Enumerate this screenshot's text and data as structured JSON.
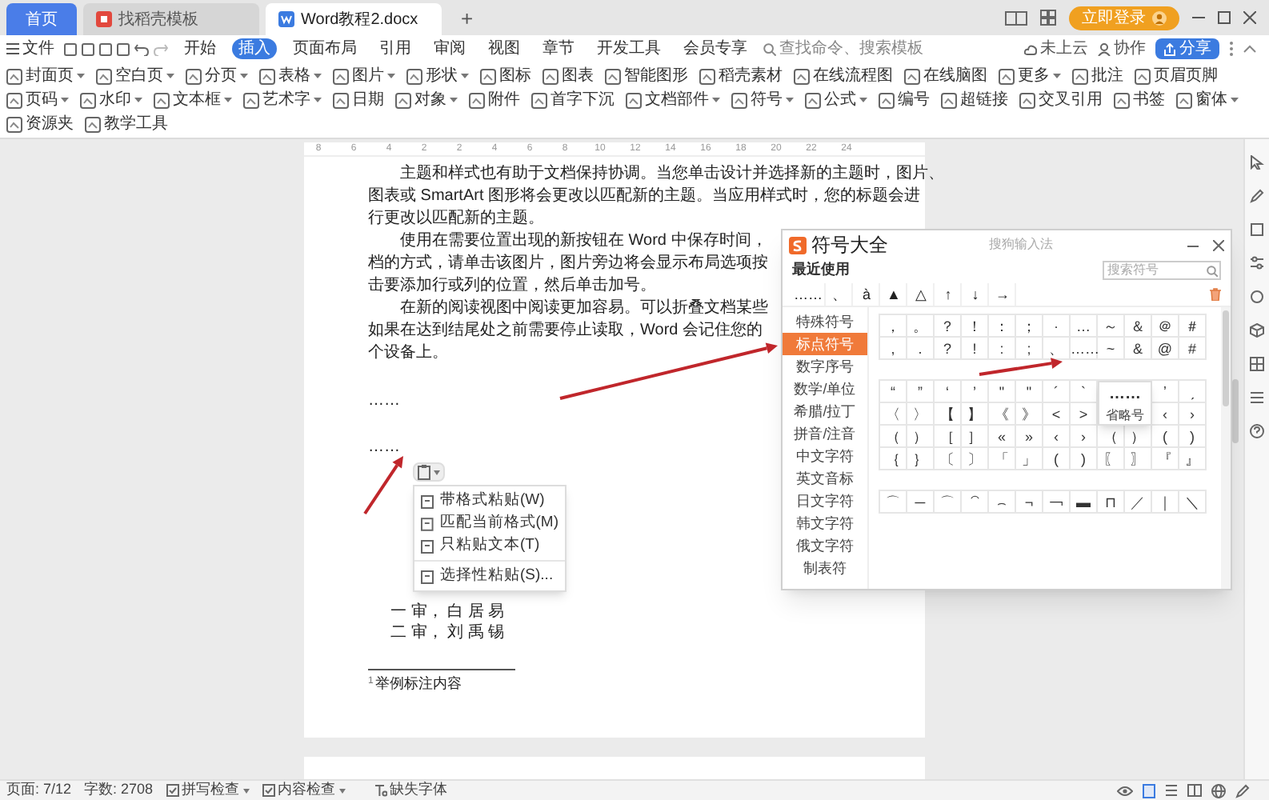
{
  "tabs": [
    {
      "label": "首页",
      "kind": "home",
      "selected": false
    },
    {
      "label": "找稻壳模板",
      "kind": "template",
      "selected": false
    },
    {
      "label": "Word教程2.docx",
      "kind": "doc",
      "selected": true
    }
  ],
  "new_tab": "+",
  "login_button": "立即登录",
  "menu": {
    "file": "文件",
    "items": [
      {
        "label": "开始",
        "selected": false
      },
      {
        "label": "插入",
        "selected": true
      },
      {
        "label": "页面布局",
        "selected": false
      },
      {
        "label": "引用",
        "selected": false
      },
      {
        "label": "审阅",
        "selected": false
      },
      {
        "label": "视图",
        "selected": false
      },
      {
        "label": "章节",
        "selected": false
      },
      {
        "label": "开发工具",
        "selected": false
      },
      {
        "label": "会员专享",
        "selected": false
      }
    ],
    "search": {
      "placeholder": "查找命令、搜索模板"
    },
    "actions": [
      "未上云",
      "协作"
    ],
    "share": "分享"
  },
  "ribbon": [
    {
      "label": "封面页",
      "dropdown": true
    },
    {
      "label": "空白页",
      "dropdown": true
    },
    {
      "label": "分页",
      "dropdown": true
    },
    {
      "label": "表格",
      "dropdown": true
    },
    {
      "label": "图片",
      "dropdown": true
    },
    {
      "label": "形状",
      "dropdown": true
    },
    {
      "label": "图标",
      "dropdown": false
    },
    {
      "label": "图表",
      "dropdown": false
    },
    {
      "label": "智能图形",
      "dropdown": false
    },
    {
      "label": "稻壳素材",
      "dropdown": false
    },
    {
      "label": "在线流程图",
      "dropdown": false
    },
    {
      "label": "在线脑图",
      "dropdown": false
    },
    {
      "label": "更多",
      "dropdown": true
    },
    {
      "label": "批注",
      "dropdown": false
    },
    {
      "label": "页眉页脚",
      "dropdown": false
    },
    {
      "label": "页码",
      "dropdown": true
    },
    {
      "label": "水印",
      "dropdown": true
    },
    {
      "label": "文本框",
      "dropdown": true
    },
    {
      "label": "艺术字",
      "dropdown": true
    },
    {
      "label": "日期",
      "dropdown": false
    },
    {
      "label": "对象",
      "dropdown": true
    },
    {
      "label": "附件",
      "dropdown": false
    },
    {
      "label": "首字下沉",
      "dropdown": false
    },
    {
      "label": "文档部件",
      "dropdown": true
    },
    {
      "label": "符号",
      "dropdown": true
    },
    {
      "label": "公式",
      "dropdown": true
    },
    {
      "label": "编号",
      "dropdown": false
    },
    {
      "label": "超链接",
      "dropdown": false
    },
    {
      "label": "交叉引用",
      "dropdown": false
    },
    {
      "label": "书签",
      "dropdown": false
    },
    {
      "label": "窗体",
      "dropdown": true
    },
    {
      "label": "资源夹",
      "dropdown": false
    },
    {
      "label": "教学工具",
      "dropdown": false
    }
  ],
  "document": {
    "ruler": [
      "8",
      "6",
      "4",
      "2",
      "2",
      "4",
      "6",
      "8",
      "10",
      "12",
      "14",
      "16",
      "18",
      "20",
      "22",
      "24"
    ],
    "paragraphs": [
      [
        "主题和样式也有助于文档保持协调。当您单击设计并选择新的主题时，图片、",
        "图表或 SmartArt 图形将会更改以匹配新的主题。当应用样式时，您的标题会进",
        "行更改以匹配新的主题。"
      ],
      [
        "使用在需要位置出现的新按钮在 Word 中保存时间，",
        "档的方式，请单击该图片，图片旁边将会显示布局选项按",
        "击要添加行或列的位置，然后单击加号。"
      ],
      [
        "在新的阅读视图中阅读更加容易。可以折叠文档某些",
        "如果在达到结尾处之前需要停止读取，Word 会记住您的",
        "个设备上。"
      ]
    ],
    "ellipses": [
      "……",
      "……"
    ],
    "paste_menu": [
      "带格式粘贴(W)",
      "匹配当前格式(M)",
      "只粘贴文本(T)",
      "选择性粘贴(S)..."
    ],
    "reviewers": [
      "一 审， 白 居 易",
      "二 审， 刘 禹 锡"
    ],
    "footnote_mark": "1",
    "footnote": "举例标注内容"
  },
  "symbol_dialog": {
    "title": "符号大全",
    "source": "搜狗输入法",
    "recent_heading": "最近使用",
    "search": {
      "placeholder": "搜索符号"
    },
    "recent": [
      "……",
      "、",
      "à",
      "▲",
      "△",
      "↑",
      "↓",
      "→"
    ],
    "categories": [
      {
        "label": "特殊符号",
        "selected": false
      },
      {
        "label": "标点符号",
        "selected": true
      },
      {
        "label": "数字序号",
        "selected": false
      },
      {
        "label": "数学/单位",
        "selected": false
      },
      {
        "label": "希腊/拉丁",
        "selected": false
      },
      {
        "label": "拼音/注音",
        "selected": false
      },
      {
        "label": "中文字符",
        "selected": false
      },
      {
        "label": "英文音标",
        "selected": false
      },
      {
        "label": "日文字符",
        "selected": false
      },
      {
        "label": "韩文字符",
        "selected": false
      },
      {
        "label": "俄文字符",
        "selected": false
      },
      {
        "label": "制表符",
        "selected": false
      }
    ],
    "groups": [
      {
        "rows": [
          [
            "，",
            "。",
            "？",
            "！",
            "：",
            "；",
            "·",
            "…",
            "～",
            "＆",
            "＠",
            "＃"
          ],
          [
            ",",
            ".",
            "?",
            "!",
            ":",
            ";",
            "、",
            "……",
            "~",
            "&",
            "@",
            "#"
          ]
        ]
      },
      {
        "tooltip": {
          "symbol": "……",
          "label": "省略号"
        },
        "rows": [
          [
            "“",
            "”",
            "‘",
            "’",
            "\"",
            "\"",
            "´",
            "`",
            "ʼ",
            "ˏ"
          ],
          [
            "〈",
            "〉",
            "【",
            "】",
            "《",
            "》",
            "<",
            ">",
            "‹",
            "›"
          ],
          [
            "（",
            "）",
            "［",
            "］",
            "«",
            "»",
            "‹",
            "›",
            "（",
            "）",
            "(",
            ")"
          ],
          [
            "｛",
            "｝",
            "〔",
            "〕",
            "「",
            "」",
            "(",
            ")",
            "〖",
            "〗",
            "『",
            "』"
          ]
        ]
      },
      {
        "rows": [
          [
            "⌒",
            "─",
            "⌒",
            "⁀",
            "⌢",
            "¬",
            "￢",
            "▬",
            "⊓",
            "／",
            "｜",
            "＼"
          ]
        ]
      }
    ]
  },
  "status_bar": [
    {
      "label": "页面: 7/12",
      "kind": "plain"
    },
    {
      "label": "字数: 2708",
      "kind": "plain"
    },
    {
      "label": "拼写检查",
      "kind": "check"
    },
    {
      "label": "内容检查",
      "kind": "check"
    },
    {
      "label": "缺失字体",
      "kind": "font"
    }
  ]
}
